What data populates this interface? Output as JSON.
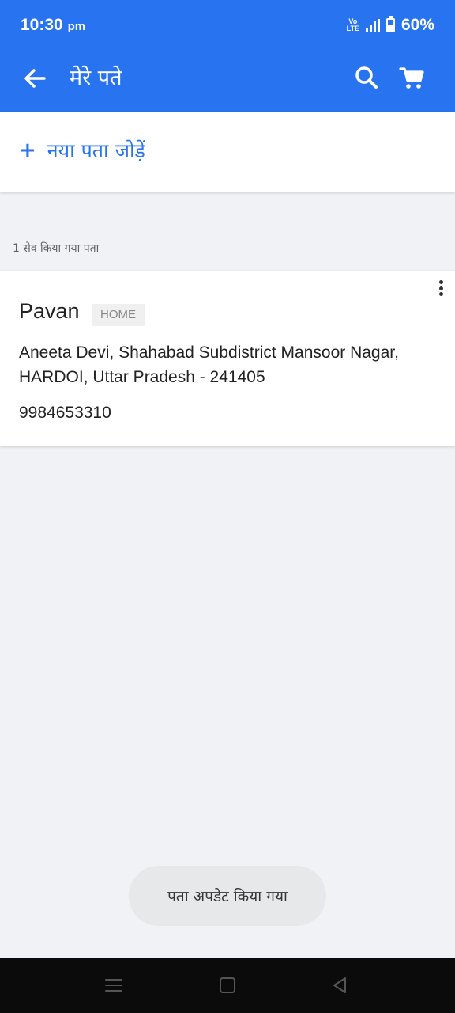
{
  "status_bar": {
    "time": "10:30",
    "ampm": "pm",
    "network_top": "Vo",
    "network_bottom": "LTE",
    "battery": "60%"
  },
  "app_bar": {
    "title": "मेरे पते",
    "icons": [
      "back-arrow-icon",
      "search-icon",
      "cart-icon"
    ]
  },
  "add_address": {
    "plus": "+",
    "label": "नया पता जोड़ें"
  },
  "saved_count": "1 सेव किया गया पता",
  "address": {
    "name": "Pavan",
    "tag": "HOME",
    "text": "Aneeta Devi, Shahabad Subdistrict Mansoor Nagar, HARDOI, Uttar Pradesh - 241405",
    "phone": "9984653310"
  },
  "toast": "पता अपडेट किया गया",
  "colors": {
    "primary": "#2874f0",
    "background": "#f1f2f6",
    "navbar": "#0b0b0b"
  }
}
